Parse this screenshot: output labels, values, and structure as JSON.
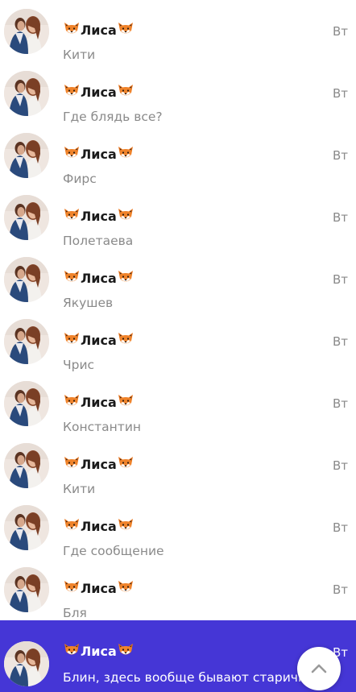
{
  "chats": [
    {
      "name": "Лиса",
      "time": "Вт",
      "message": "Кити",
      "selected": false
    },
    {
      "name": "Лиса",
      "time": "Вт",
      "message": "Где блядь все?",
      "selected": false
    },
    {
      "name": "Лиса",
      "time": "Вт",
      "message": "Фирс",
      "selected": false
    },
    {
      "name": "Лиса",
      "time": "Вт",
      "message": "Полетаева",
      "selected": false
    },
    {
      "name": "Лиса",
      "time": "Вт",
      "message": "Якушев",
      "selected": false
    },
    {
      "name": "Лиса",
      "time": "Вт",
      "message": "Чрис",
      "selected": false
    },
    {
      "name": "Лиса",
      "time": "Вт",
      "message": "Константин",
      "selected": false
    },
    {
      "name": "Лиса",
      "time": "Вт",
      "message": "Кити",
      "selected": false
    },
    {
      "name": "Лиса",
      "time": "Вт",
      "message": "Где сообщение",
      "selected": false
    },
    {
      "name": "Лиса",
      "time": "Вт",
      "message": "Бля",
      "selected": false
    },
    {
      "name": "Лиса",
      "time": "Вт",
      "message": "Блин, здесь вообще бывают старички?",
      "selected": true
    }
  ],
  "name_decoration_icon": "fox-face-icon",
  "scroll_button_icon": "chevron-up-icon",
  "colors": {
    "selected_background": "#4536d6",
    "secondary_text": "#8a8a8a",
    "name_text": "#1a1a1a"
  }
}
